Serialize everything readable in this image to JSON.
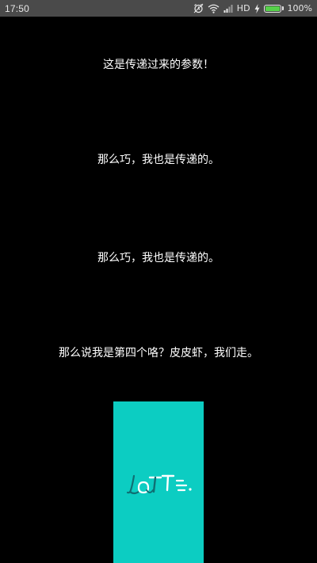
{
  "status_bar": {
    "time": "17:50",
    "network": "HD",
    "battery_percent_label": "100%",
    "battery_level": 1.0,
    "icons": [
      "alarm-icon",
      "wifi-icon",
      "signal-icon",
      "charging-bolt-icon",
      "battery-icon"
    ],
    "battery_color": "#56d14a"
  },
  "content": {
    "line1": "这是传递过来的参数！",
    "line2": "那么巧，我也是传递的。",
    "line3": "那么巧，我也是传递的。",
    "line4": "那么说我是第四个咯？皮皮虾，我们走。"
  },
  "lottie": {
    "background_color": "#0ccdc2",
    "logo_name": "lottie-logo-animation"
  }
}
